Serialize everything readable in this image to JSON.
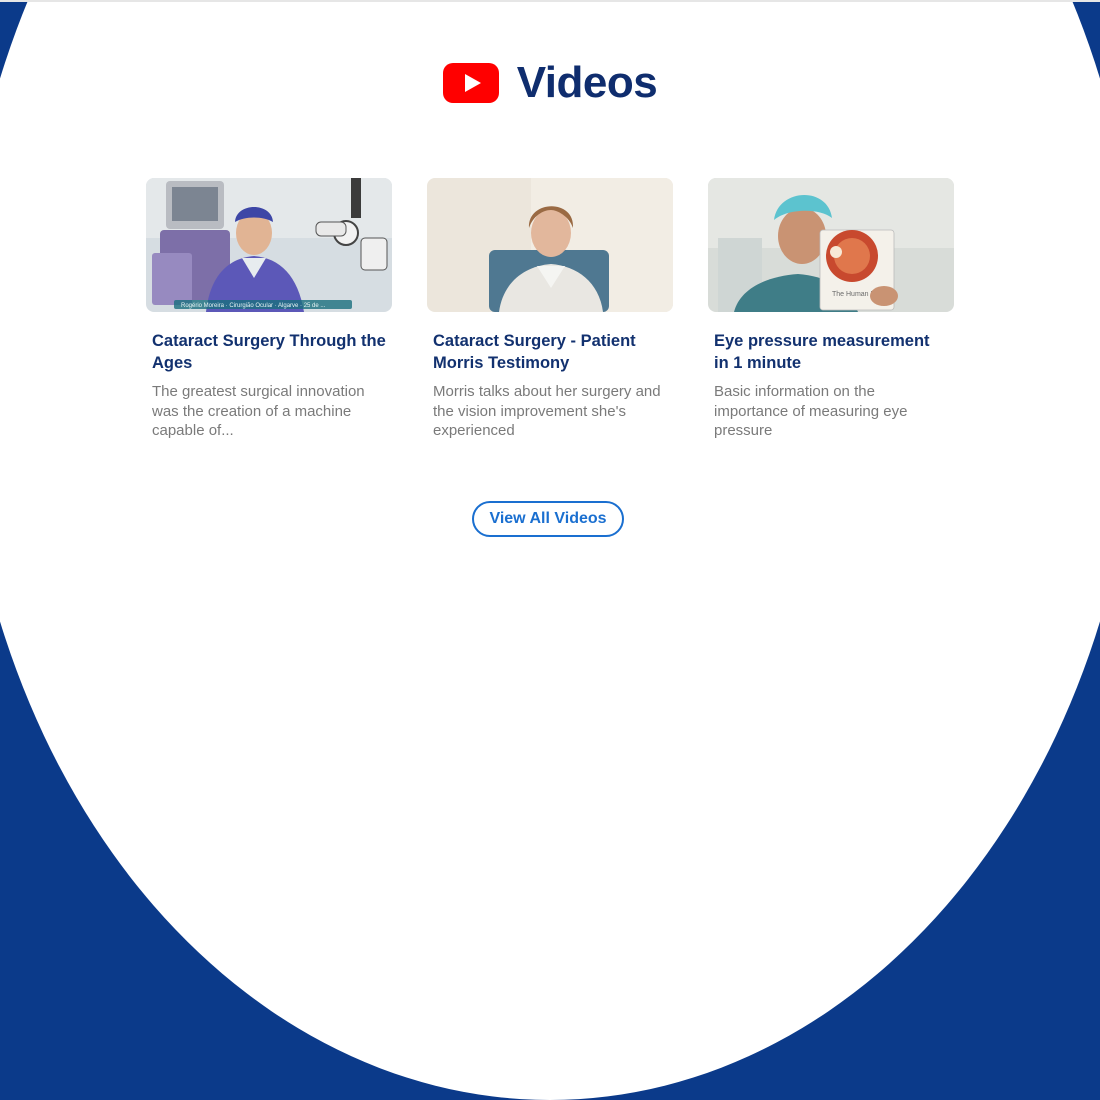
{
  "section": {
    "title": "Videos",
    "icon": "youtube-icon",
    "icon_color": "#ff0000",
    "title_color": "#0f2d6e"
  },
  "videos": [
    {
      "title": "Cataract Surgery Through the Ages",
      "description": "The greatest surgical innovation was the creation of a machine capable of...",
      "thumbnail_caption": "Rogério Moreira · Cirurgião Ocular · Algarve · 25 de ..."
    },
    {
      "title": "Cataract Surgery - Patient Morris Testimony",
      "description": "Morris talks about her surgery and the vision improvement she's experienced"
    },
    {
      "title": "Eye pressure measurement in 1 minute",
      "description": "Basic information on the importance of measuring eye pressure",
      "thumbnail_caption": "The Human Eye"
    }
  ],
  "view_all_label": "View All Videos",
  "colors": {
    "accent": "#1a6fd0",
    "background_curve": "#0b3a8a",
    "card_title": "#12316f",
    "card_text": "#7a7a7a"
  }
}
